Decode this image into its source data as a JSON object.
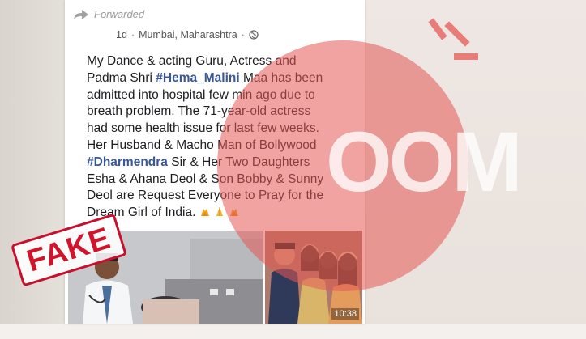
{
  "post": {
    "forwarded_label": "Forwarded",
    "time_ago": "1d",
    "separator": "·",
    "location": "Mumbai, Maharashtra",
    "audience_icon": "globe-icon",
    "body": {
      "p1": "My Dance & acting Guru, Actress and\nPadma Shri ",
      "hashtag1": "#Hema_Malini",
      "p2": " Maa has been\nadmitted into hospital few min ago due to\nbreath problem. The 71-year-old actress\nhad some health issue for last few weeks.\nHer Husband & Macho Man of Bollywood\n",
      "hashtag2": "#Dharmendra",
      "p3": " Sir & Her Two Daughters\nEsha & Ahana Deol & Son Bobby & Sunny\nDeol are Request Everyone to Pray for the\nDream Girl of India. "
    },
    "emojis": [
      "praying-hands-icon",
      "folded-hands-icon",
      "praying-hands-icon"
    ],
    "video_duration": "10:38"
  },
  "overlay": {
    "fake_stamp": "FAKE",
    "watermark_text": "OOM",
    "watermark_color": "#e45854"
  },
  "colors": {
    "hashtag": "#385898",
    "stamp": "#d0142c",
    "background": "#e6e2dc"
  }
}
